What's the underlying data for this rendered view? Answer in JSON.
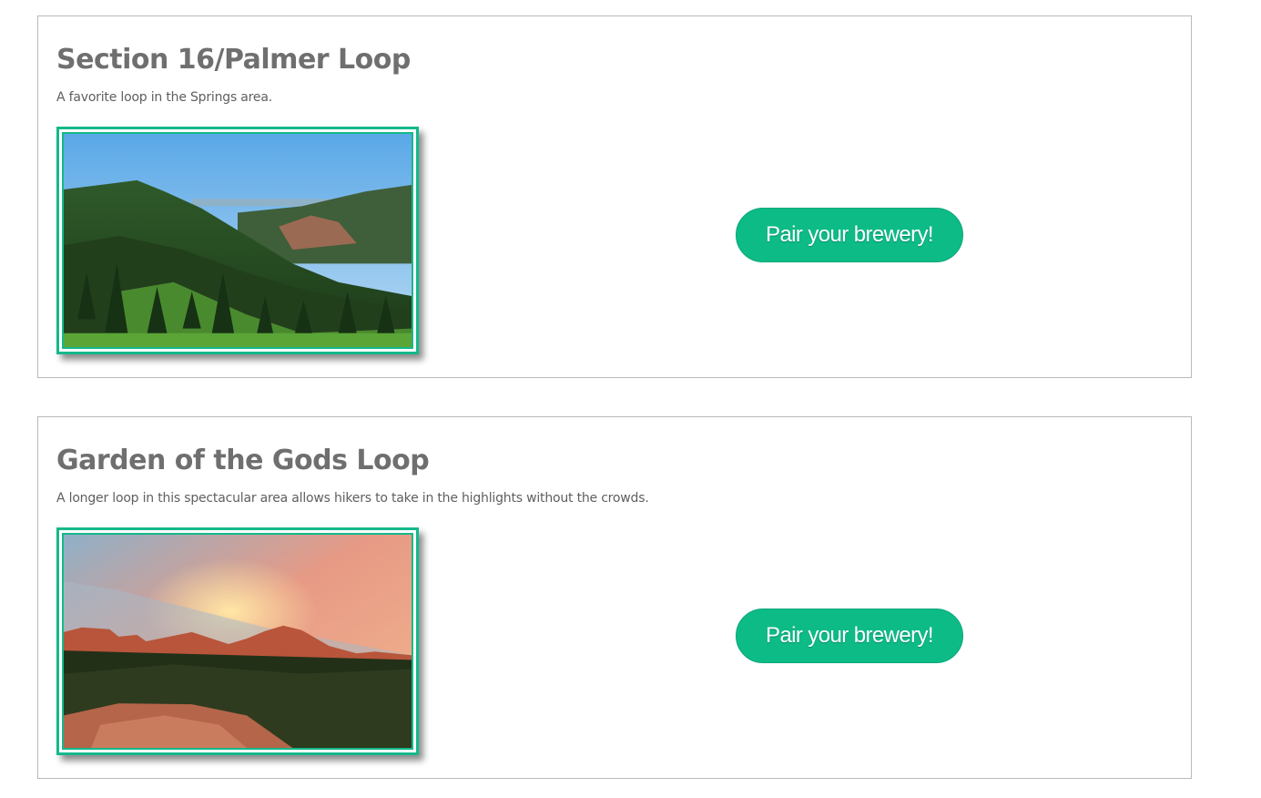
{
  "trails": [
    {
      "title": "Section 16/Palmer Loop",
      "description": "A favorite loop in the Springs area.",
      "button_label": "Pair your brewery!",
      "photo_icon": "mountain-forest-photo"
    },
    {
      "title": "Garden of the Gods Loop",
      "description": "A longer loop in this spectacular area allows hikers to take in the highlights without the crowds.",
      "button_label": "Pair your brewery!",
      "photo_icon": "sunset-rocks-photo"
    }
  ],
  "colors": {
    "accent": "#0dbb86",
    "frame": "#14b98a",
    "title_text": "#6f6f6f",
    "card_border": "#b9b9b9"
  }
}
